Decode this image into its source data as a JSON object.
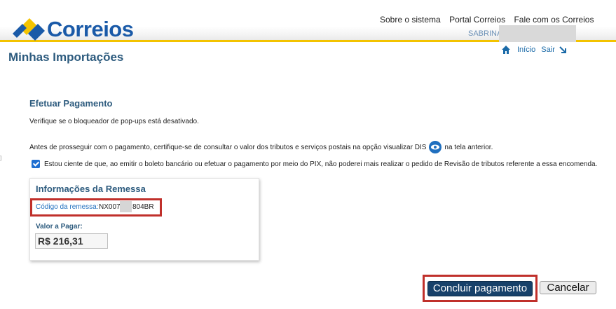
{
  "header": {
    "brand": "Correios",
    "links": [
      "Sobre o sistema",
      "Portal Correios",
      "Fale com os Correios"
    ],
    "user_name": "SABRINA",
    "accent": "#f3c300"
  },
  "page": {
    "title": "Minhas Importações",
    "nav": {
      "home_label": "Início",
      "exit_label": "Sair"
    }
  },
  "payment": {
    "section_title": "Efetuar Pagamento",
    "popup_notice": "Verifique se o bloqueador de pop-ups está desativado.",
    "consult_notice_before": "Antes de prosseguir com o pagamento, certifique-se de consultar o valor dos tributos e serviços postais na opção visualizar DIS",
    "consult_notice_after": "na tela anterior.",
    "consent_label": "Estou ciente de que, ao emitir o boleto bancário ou efetuar o pagamento por meio do PIX, não poderei mais realizar o pedido de Revisão de tributos referente a essa encomenda.",
    "consent_checked": true
  },
  "shipment": {
    "title": "Informações da Remessa",
    "code_label": "Código da remessa:",
    "code_prefix": "NX007",
    "code_suffix": "804BR",
    "amount_label": "Valor a Pagar:",
    "amount_value": "R$ 216,31"
  },
  "actions": {
    "confirm_label": "Concluir pagamento",
    "cancel_label": "Cancelar"
  },
  "colors": {
    "brand_blue": "#1a5aa8",
    "title_blue": "#2d5b7e",
    "highlight_red": "#c0302b",
    "primary_button": "#17416a"
  },
  "misc": {
    "left_mark": "]"
  }
}
